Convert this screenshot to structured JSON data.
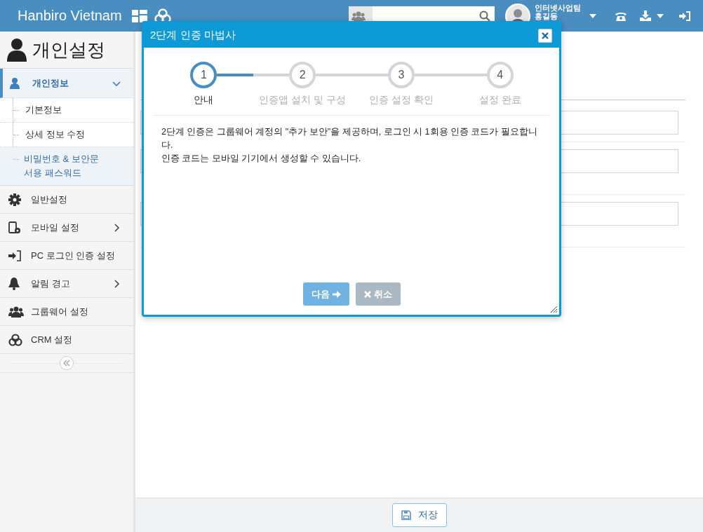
{
  "header": {
    "brand": "Hanbiro Vietnam",
    "user": {
      "team": "인터넷사업팀",
      "name": "홍길동"
    }
  },
  "sidebar": {
    "title": "개인설정",
    "items": [
      {
        "label": "개인정보",
        "selected": true,
        "expanded": true,
        "children": [
          {
            "label": "기본정보",
            "selected": false
          },
          {
            "label": "상세 정보 수정",
            "selected": false
          },
          {
            "label": "비밀번호 & 보안문서용 패스워드",
            "selected": true
          }
        ]
      },
      {
        "label": "일반설정",
        "selected": false
      },
      {
        "label": "모바일 설정",
        "selected": false,
        "expanded": false
      },
      {
        "label": "PC 로그인 인증 설정",
        "selected": false
      },
      {
        "label": "알림 경고",
        "selected": false,
        "expanded": false
      },
      {
        "label": "그룹웨어 설정",
        "selected": false
      },
      {
        "label": "CRM 설정",
        "selected": false
      }
    ]
  },
  "dialog": {
    "title": "2단계 인증 마법사",
    "steps": [
      {
        "number": "1",
        "label": "안내",
        "selected": true,
        "level": 0.5
      },
      {
        "number": "2",
        "label": "인증앱 설치 및 구성",
        "selected": false
      },
      {
        "number": "3",
        "label": "인증 설정 확인",
        "selected": false
      },
      {
        "number": "4",
        "label": "설정 완료",
        "selected": false
      }
    ],
    "paragraphs": [
      "2단계 인증은 그룹웨어 계정의 \"추가 보안\"을 제공하며, 로그인 시 1회용 인증 코드가 필요합니다.",
      "인증 코드는 모바일 기기에서 생성할 수 있습니다."
    ],
    "buttons": [
      {
        "label": "다음",
        "kind": "next"
      },
      {
        "label": "취소",
        "kind": "cancel"
      }
    ]
  },
  "footer": {
    "save_button": "저장"
  }
}
